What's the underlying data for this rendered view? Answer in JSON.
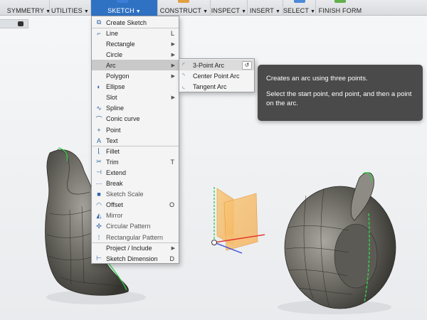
{
  "toolbar": {
    "items": [
      {
        "label": "SYMMETRY",
        "color": "#7a7fd0"
      },
      {
        "label": "UTILITIES",
        "color": "#9fa5ad"
      },
      {
        "label": "SKETCH",
        "color": "#3d7ed8"
      },
      {
        "label": "CONSTRUCT",
        "color": "#e0a040"
      },
      {
        "label": "INSPECT",
        "color": "#8aa4c0"
      },
      {
        "label": "INSERT",
        "color": "#9a9a9a"
      },
      {
        "label": "SELECT",
        "color": "#4a8ad8"
      },
      {
        "label": "FINISH FORM",
        "color": "#62b04a"
      }
    ]
  },
  "menu": {
    "items": [
      {
        "label": "Create Sketch",
        "shortcut": "",
        "submenu": false,
        "icon": "create-sketch-icon",
        "glyph": "⧉"
      },
      {
        "label": "Line",
        "shortcut": "L",
        "submenu": false,
        "icon": "line-icon",
        "glyph": "⌐"
      },
      {
        "label": "Rectangle",
        "shortcut": "",
        "submenu": true,
        "icon": "",
        "glyph": ""
      },
      {
        "label": "Circle",
        "shortcut": "",
        "submenu": true,
        "icon": "",
        "glyph": ""
      },
      {
        "label": "Arc",
        "shortcut": "",
        "submenu": true,
        "icon": "",
        "glyph": ""
      },
      {
        "label": "Polygon",
        "shortcut": "",
        "submenu": true,
        "icon": "",
        "glyph": ""
      },
      {
        "label": "Ellipse",
        "shortcut": "",
        "submenu": false,
        "icon": "ellipse-icon",
        "glyph": "◐"
      },
      {
        "label": "Slot",
        "shortcut": "",
        "submenu": true,
        "icon": "",
        "glyph": ""
      },
      {
        "label": "Spline",
        "shortcut": "",
        "submenu": false,
        "icon": "spline-icon",
        "glyph": "∿"
      },
      {
        "label": "Conic curve",
        "shortcut": "",
        "submenu": false,
        "icon": "conic-curve-icon",
        "glyph": "⌒"
      },
      {
        "label": "Point",
        "shortcut": "",
        "submenu": false,
        "icon": "point-icon",
        "glyph": "+"
      },
      {
        "label": "Text",
        "shortcut": "",
        "submenu": false,
        "icon": "text-icon",
        "glyph": "A"
      },
      {
        "label": "Fillet",
        "shortcut": "",
        "submenu": false,
        "icon": "fillet-icon",
        "glyph": "⌊"
      },
      {
        "label": "Trim",
        "shortcut": "T",
        "submenu": false,
        "icon": "trim-icon",
        "glyph": "✂"
      },
      {
        "label": "Extend",
        "shortcut": "",
        "submenu": false,
        "icon": "extend-icon",
        "glyph": "⊣"
      },
      {
        "label": "Break",
        "shortcut": "",
        "submenu": false,
        "icon": "break-icon",
        "glyph": "⋯"
      },
      {
        "label": "Sketch Scale",
        "shortcut": "",
        "submenu": false,
        "icon": "sketch-scale-icon",
        "glyph": "■"
      },
      {
        "label": "Offset",
        "shortcut": "O",
        "submenu": false,
        "icon": "offset-icon",
        "glyph": "◠"
      },
      {
        "label": "Mirror",
        "shortcut": "",
        "submenu": false,
        "icon": "mirror-icon",
        "glyph": "◭"
      },
      {
        "label": "Circular Pattern",
        "shortcut": "",
        "submenu": false,
        "icon": "circular-pattern-icon",
        "glyph": "✣"
      },
      {
        "label": "Rectangular Pattern",
        "shortcut": "",
        "submenu": false,
        "icon": "rectangular-pattern-icon",
        "glyph": "⁞"
      },
      {
        "label": "Project / Include",
        "shortcut": "",
        "submenu": true,
        "icon": "",
        "glyph": ""
      },
      {
        "label": "Sketch Dimension",
        "shortcut": "D",
        "submenu": false,
        "icon": "sketch-dimension-icon",
        "glyph": "⊢"
      }
    ]
  },
  "arc_submenu": {
    "items": [
      {
        "label": "3-Point Arc",
        "glyph": "◜"
      },
      {
        "label": "Center Point Arc",
        "glyph": "◝"
      },
      {
        "label": "Tangent Arc",
        "glyph": "◟"
      }
    ],
    "undo_glyph": "↺"
  },
  "tooltip": {
    "title": "Creates an arc using three points.",
    "body": "Select the start point, end point, and then a point on the arc."
  },
  "colors": {
    "accent": "#2f72c4",
    "shape_body": "#6f6d66",
    "edge_green": "#34d04a",
    "plane_orange": "#f5b660"
  }
}
